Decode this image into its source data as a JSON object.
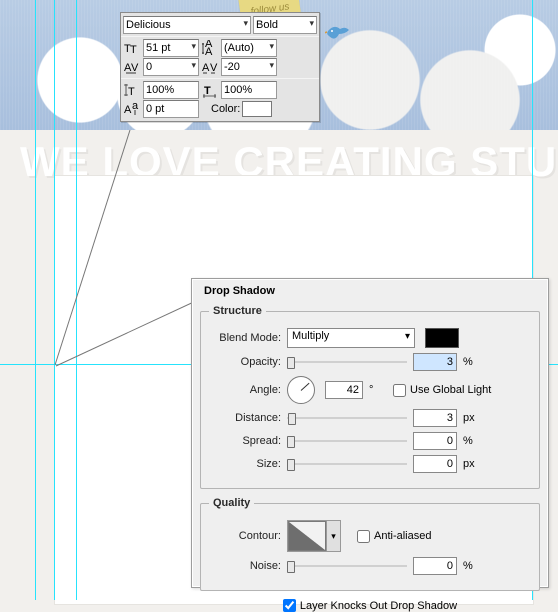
{
  "decor": {
    "follow_us": "follow us",
    "hero_text": "WE LOVE CREATING STUFF"
  },
  "char_panel": {
    "font_family": "Delicious",
    "font_style": "Bold",
    "font_size": "51 pt",
    "leading": "(Auto)",
    "kerning": "0",
    "tracking": "-20",
    "v_scale": "100%",
    "h_scale": "100%",
    "baseline": "0 pt",
    "color_label": "Color:"
  },
  "drop_shadow": {
    "title": "Drop Shadow",
    "structure_legend": "Structure",
    "blend_mode_label": "Blend Mode:",
    "blend_mode_value": "Multiply",
    "opacity_label": "Opacity:",
    "opacity_value": "3",
    "angle_label": "Angle:",
    "angle_value": "42",
    "angle_degree": "°",
    "use_global_light": "Use Global Light",
    "distance_label": "Distance:",
    "distance_value": "3",
    "spread_label": "Spread:",
    "spread_value": "0",
    "size_label": "Size:",
    "size_value": "0",
    "px": "px",
    "pct": "%",
    "quality_legend": "Quality",
    "contour_label": "Contour:",
    "anti_aliased": "Anti-aliased",
    "noise_label": "Noise:",
    "noise_value": "0",
    "knock_out": "Layer Knocks Out Drop Shadow"
  }
}
